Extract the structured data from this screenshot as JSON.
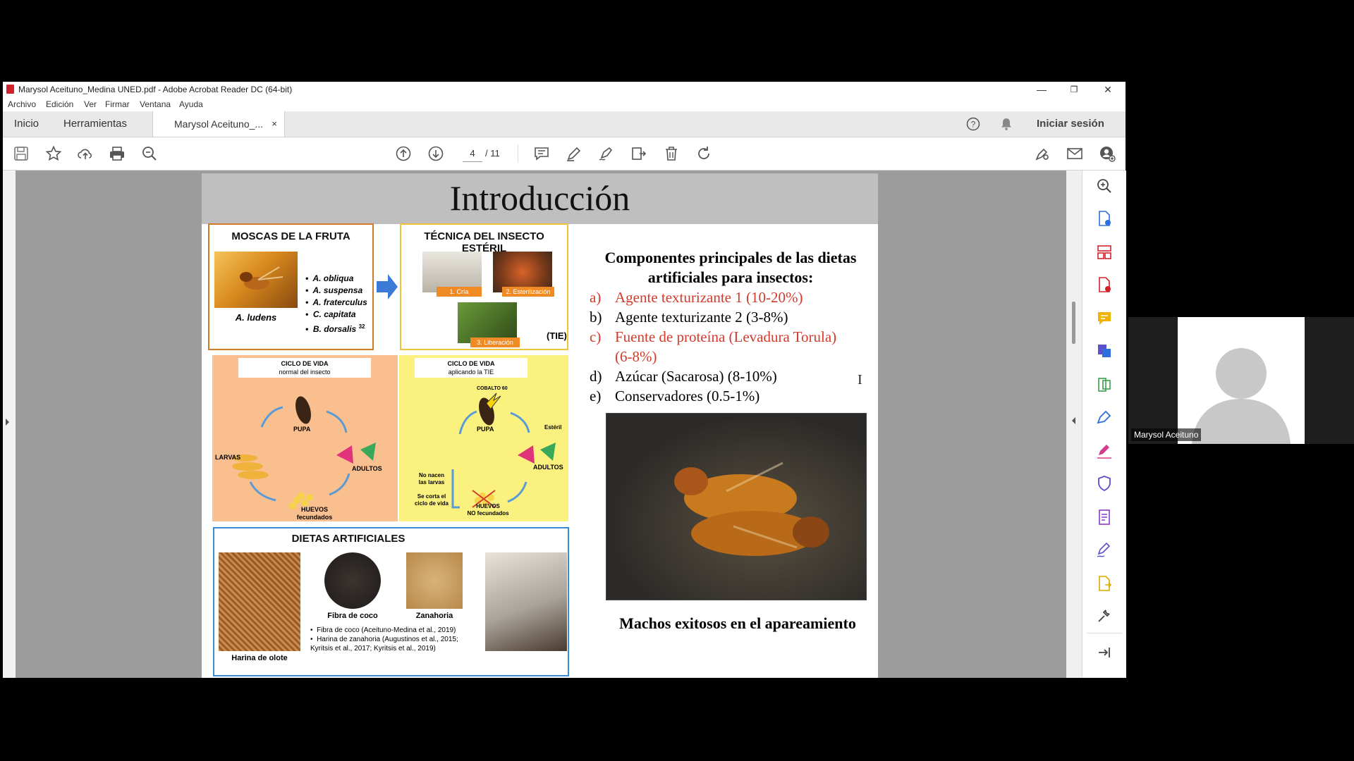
{
  "window": {
    "title": "Marysol Aceituno_Medina UNED.pdf - Adobe Acrobat Reader DC (64-bit)",
    "minimize": "—",
    "restore": "❐",
    "close": "✕"
  },
  "menu": [
    "Archivo",
    "Edición",
    "Ver",
    "Firmar",
    "Ventana",
    "Ayuda"
  ],
  "tabs": {
    "home": "Inicio",
    "tools": "Herramientas",
    "doc": "Marysol Aceituno_...",
    "doc_close": "×",
    "signin": "Iniciar sesión"
  },
  "toolbar": {
    "page_current": "4",
    "page_total": "/ 11"
  },
  "slide": {
    "title": "Introducción",
    "box1": {
      "title": "MOSCAS DE LA FRUTA",
      "caption": "A. ludens",
      "species": [
        "A. obliqua",
        "A. suspensa",
        "A. fraterculus",
        "C. capitata",
        "B. dorsalis"
      ],
      "ref": "32"
    },
    "box2": {
      "title": "TÉCNICA DEL INSECTO ESTÉRIL",
      "steps": [
        "1. Cría",
        "2. Esterilización",
        "3. Liberación"
      ],
      "abbr": "(TIE)"
    },
    "cycle1": {
      "title": "CICLO DE VIDA",
      "subtitle": "normal del insecto",
      "pupa": "PUPA",
      "larvas": "LARVAS",
      "adultos": "ADULTOS",
      "huevos": "HUEVOS",
      "huevos_sub": "fecundados"
    },
    "cycle2": {
      "title": "CICLO DE VIDA",
      "subtitle": "aplicando la TIE",
      "cobalto": "COBALTO 60",
      "pupa": "PUPA",
      "esteril": "Estéril",
      "adultos": "ADULTOS",
      "no_nacen": "No nacen",
      "las_larvas": "las larvas",
      "se_corta": "Se corta el",
      "ciclo": "ciclo de vida",
      "huevos": "HUEVOS",
      "huevos_sub": "NO fecundados"
    },
    "dietas": {
      "title": "DIETAS ARTIFICIALES",
      "olote": "Harina de olote",
      "coco": "Fibra de coco",
      "zanahoria": "Zanahoria",
      "refs": [
        "Fibra de coco (Aceituno-Medina et al., 2019)",
        "Harina de zanahoria (Augustinos et al., 2015; Kyritsis et al., 2017; Kyritsis et al., 2019)"
      ]
    },
    "components": {
      "title": "Componentes principales de las dietas artificiales para insectos:",
      "items": [
        {
          "letter": "a)",
          "text": "Agente texturizante 1 (10-20%)",
          "red": true
        },
        {
          "letter": "b)",
          "text": "Agente texturizante 2 (3-8%)",
          "red": false
        },
        {
          "letter": "c)",
          "text": "Fuente de proteína (Levadura Torula)",
          "red": true
        },
        {
          "letter": "",
          "text": "(6-8%)",
          "red": true
        },
        {
          "letter": "d)",
          "text": "Azúcar (Sacarosa) (8-10%)",
          "red": false
        },
        {
          "letter": "e)",
          "text": "Conservadores (0.5-1%)",
          "red": false
        }
      ],
      "caption": "Machos exitosos en el apareamiento"
    }
  },
  "webcam": {
    "name": "Marysol Aceituno"
  },
  "colors": {
    "accent_red": "#d33a2c",
    "pdf_red": "#d2232a"
  }
}
